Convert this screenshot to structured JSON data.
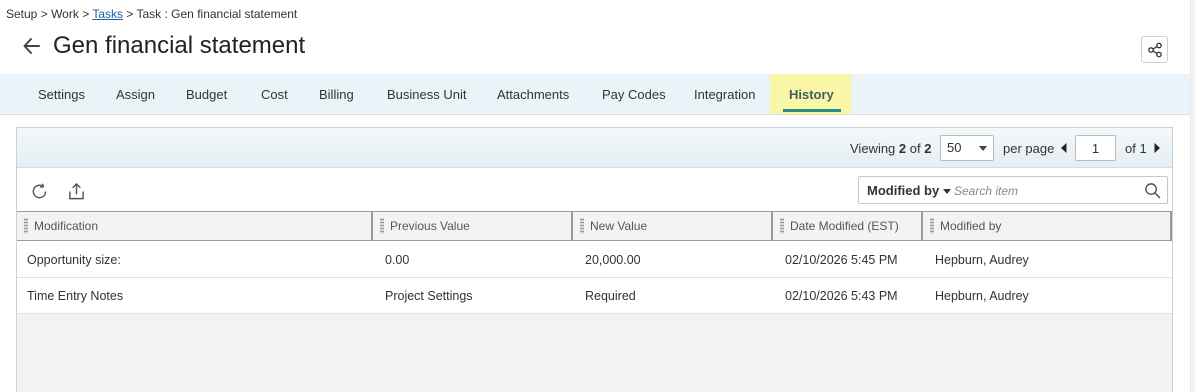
{
  "breadcrumb": {
    "setup": "Setup",
    "sep1": ">",
    "work": "Work",
    "sep2": ">",
    "tasks": "Tasks",
    "sep3": ">",
    "current": "Task : Gen financial statement"
  },
  "page": {
    "title": "Gen financial statement"
  },
  "icons": {
    "back": "arrow-left-icon",
    "share": "share-icon",
    "refresh": "refresh-icon",
    "export": "export-icon",
    "search": "search-icon",
    "prev": "triangle-left-icon",
    "next": "triangle-right-icon"
  },
  "tabs": [
    {
      "label": "Settings"
    },
    {
      "label": "Assign"
    },
    {
      "label": "Budget"
    },
    {
      "label": "Cost"
    },
    {
      "label": "Billing"
    },
    {
      "label": "Business Unit"
    },
    {
      "label": "Attachments"
    },
    {
      "label": "Pay Codes"
    },
    {
      "label": "Integration"
    },
    {
      "label": "History",
      "active": true
    }
  ],
  "pager": {
    "viewing_label": "Viewing",
    "shown": "2",
    "of_label": "of",
    "total": "2",
    "per_page_value": "50",
    "per_page_label": "per page",
    "page_value": "1",
    "page_of_label": "of 1"
  },
  "search": {
    "filter_label": "Modified by",
    "placeholder": "Search item"
  },
  "columns": [
    {
      "label": "Modification"
    },
    {
      "label": "Previous Value"
    },
    {
      "label": "New Value"
    },
    {
      "label": "Date Modified (EST)"
    },
    {
      "label": "Modified by"
    }
  ],
  "rows": [
    [
      "Opportunity size:",
      "0.00",
      "20,000.00",
      "02/10/2026 5:45 PM",
      "Hepburn, Audrey"
    ],
    [
      "Time Entry Notes",
      "Project Settings",
      "Required",
      "02/10/2026 5:43 PM",
      "Hepburn, Audrey"
    ]
  ],
  "colors": {
    "tab_bar": "#eaf3f8",
    "active_tab_highlight": "#f9f7a6",
    "active_tab_underline": "#2d8a83",
    "link": "#1f5fa8"
  }
}
